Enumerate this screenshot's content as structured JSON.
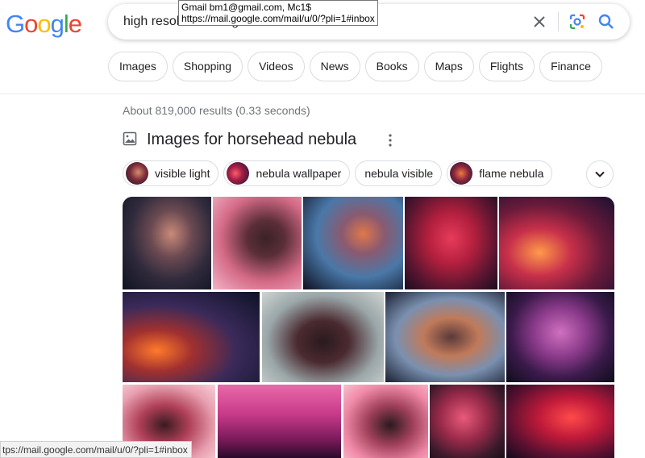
{
  "tooltip": {
    "line1": "Gmail bm1@gmail.com, Mc1$",
    "line2": "https://mail.google.com/mail/u/0/?pli=1#inbox"
  },
  "logo": {
    "letters": [
      "G",
      "o",
      "o",
      "g",
      "l",
      "e"
    ],
    "colors": [
      "#4285f4",
      "#ea4335",
      "#fbbc05",
      "#4285f4",
      "#34a853",
      "#ea4335"
    ]
  },
  "search": {
    "query": "high resolution image of horsehead nebula"
  },
  "filters": [
    "Images",
    "Shopping",
    "Videos",
    "News",
    "Books",
    "Maps",
    "Flights",
    "Finance"
  ],
  "result_stats": "About 819,000 results (0.33 seconds)",
  "images_section": {
    "title": "Images for horsehead nebula",
    "related": [
      {
        "label": "visible light",
        "thumb": true
      },
      {
        "label": "nebula wallpaper",
        "thumb": true
      },
      {
        "label": "nebula visible",
        "thumb": false
      },
      {
        "label": "flame nebula",
        "thumb": true
      }
    ]
  },
  "status_bar": "tps://mail.google.com/mail/u/0/?pli=1#inbox",
  "colors": {
    "link_blue": "#4285f4",
    "text_gray": "#70757a"
  }
}
